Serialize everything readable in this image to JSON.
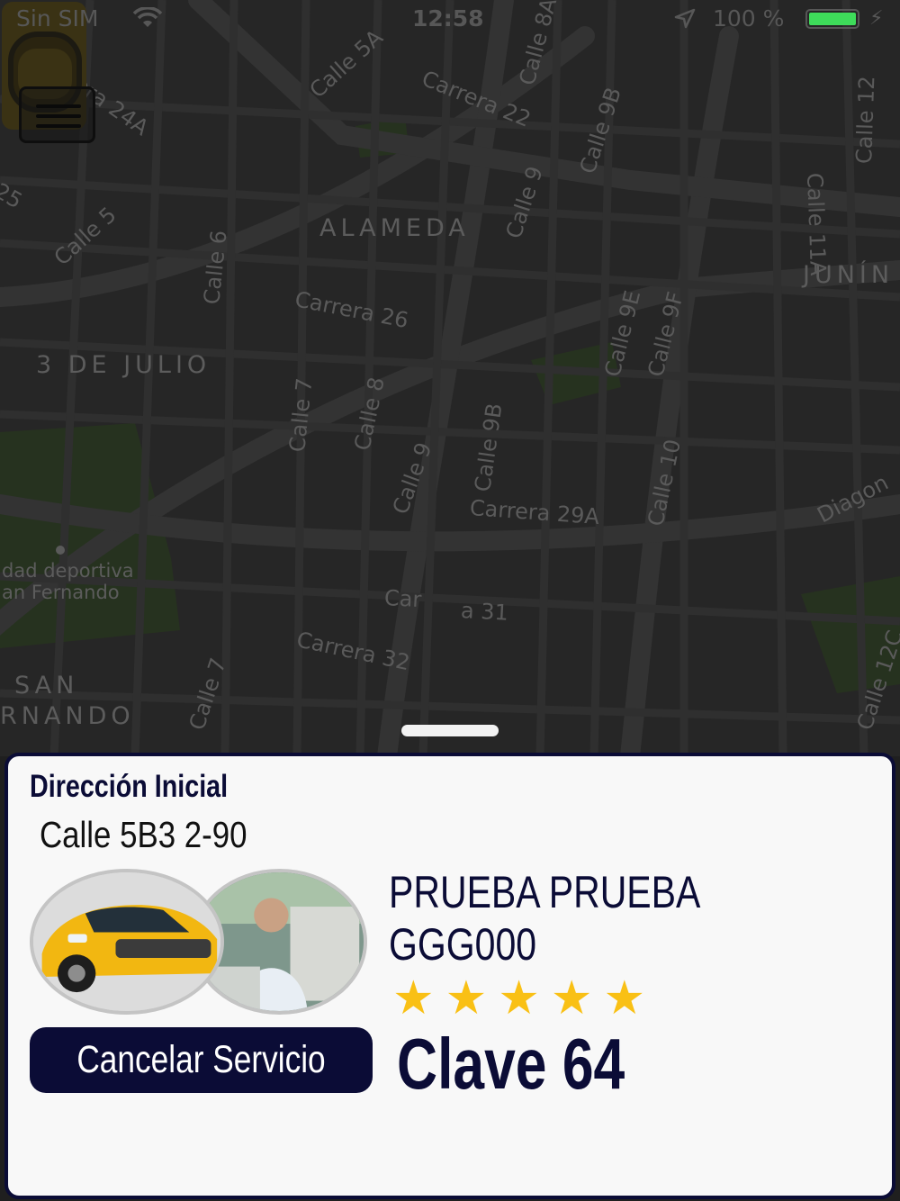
{
  "status_bar": {
    "carrier": "Sin SIM",
    "time": "12:58",
    "battery_percent": "100 %",
    "battery_level": 1.0,
    "battery_color": "#3edc5a",
    "icons": [
      "wifi-icon",
      "location-arrow-icon",
      "battery-icon",
      "charging-bolt-icon"
    ]
  },
  "map": {
    "streets": [
      "Carrera 24A",
      "Calle 5A",
      "Carrera 22",
      "Calle 8A",
      "Calle 9B",
      "Calle 12",
      "Calle 11A",
      "Calle 5",
      "Calle 6",
      "Calle 9",
      "Carrera 26",
      "Calle 9E",
      "Calle 9F",
      "Calle 7",
      "Calle 8",
      "Calle 9",
      "Calle 9B",
      "Carrera 29A",
      "Calle 10",
      "Diagon",
      "Car",
      "a 31",
      "Carrera 32",
      "Calle 7",
      "Calle 12C",
      "25"
    ],
    "areas": [
      "ALAMEDA",
      "JUNÍN",
      "3 DE JULIO",
      "SAN",
      "RNANDO"
    ],
    "poi": [
      "dad deportiva",
      "an Fernando"
    ],
    "markers": [
      "destination-pin",
      "taxi-car-marker"
    ],
    "map_colors": {
      "background": "#262626",
      "road": "#333333",
      "park": "#26321f"
    }
  },
  "menu_button": {
    "icon": "hamburger-menu-icon"
  },
  "panel": {
    "heading": "Dirección Inicial",
    "address": "Calle 5B3 2-90",
    "driver_name": "PRUEBA PRUEBA",
    "plate": "GGG000",
    "rating": 5,
    "rating_max": 5,
    "star_glyph": "★",
    "cancel_label": "Cancelar Servicio",
    "code_label": "Clave 64",
    "images": [
      "car-photo",
      "driver-photo"
    ]
  },
  "colors": {
    "primary_navy": "#0b0c36",
    "star_yellow": "#f9c015",
    "panel_bg": "#f8f8f8",
    "taxi_yellow": "#f5c518"
  }
}
